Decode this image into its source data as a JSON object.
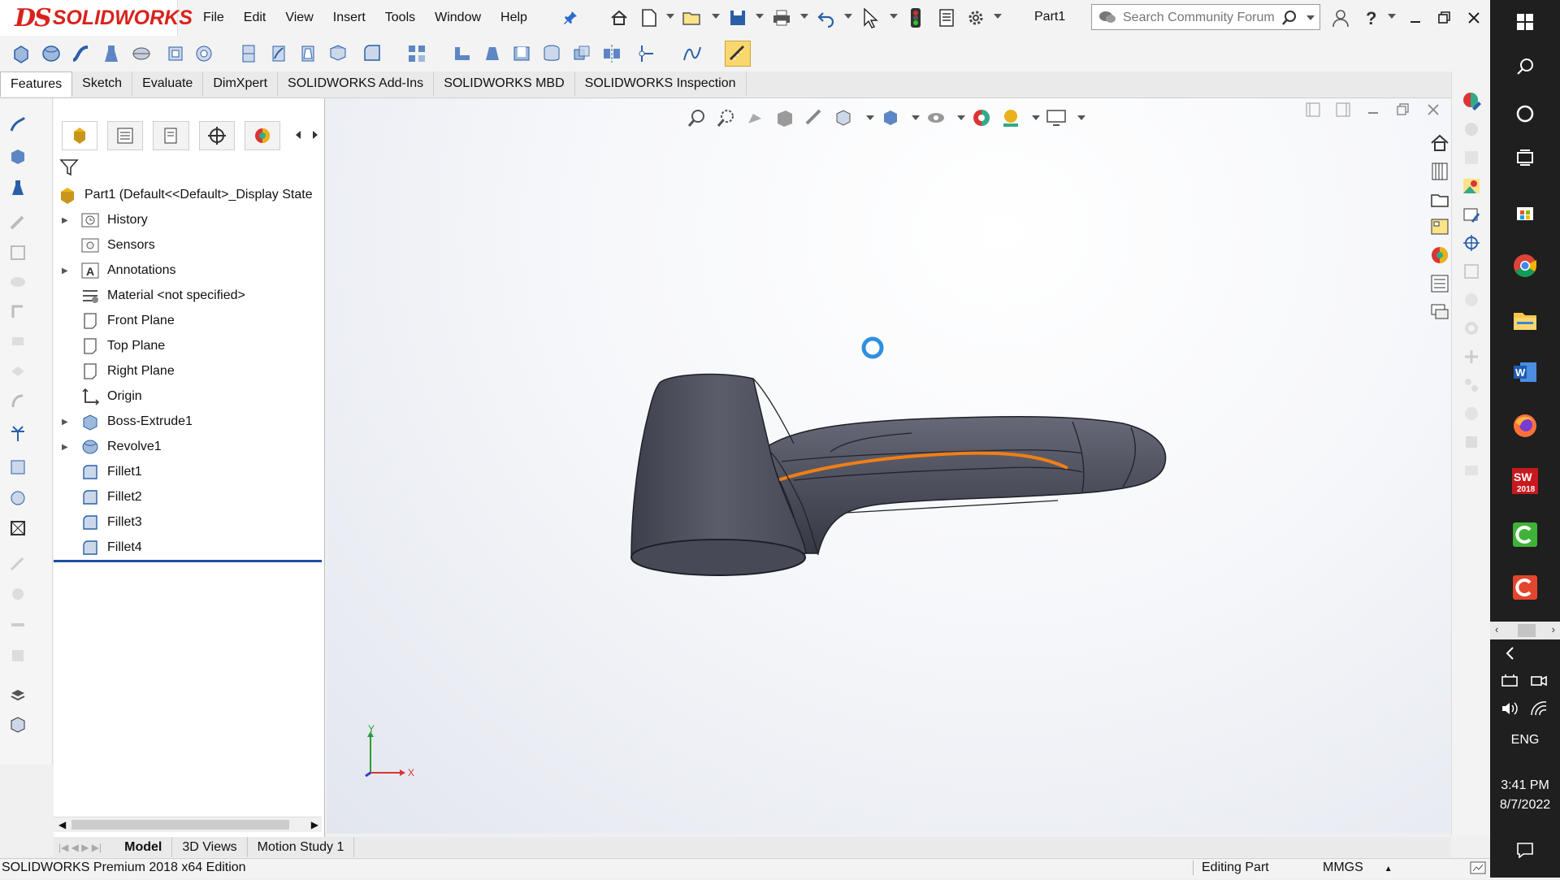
{
  "app": {
    "brand_ds": "DS",
    "brand_name": "SOLIDWORKS",
    "document_title": "Part1"
  },
  "menu": [
    "File",
    "Edit",
    "View",
    "Insert",
    "Tools",
    "Window",
    "Help"
  ],
  "search": {
    "placeholder": "Search Community Forum"
  },
  "tabs": [
    {
      "label": "Features",
      "active": true
    },
    {
      "label": "Sketch"
    },
    {
      "label": "Evaluate"
    },
    {
      "label": "DimXpert"
    },
    {
      "label": "SOLIDWORKS Add-Ins"
    },
    {
      "label": "SOLIDWORKS MBD"
    },
    {
      "label": "SOLIDWORKS Inspection"
    }
  ],
  "tree": {
    "root": "Part1  (Default<<Default>_Display State",
    "items": [
      {
        "label": "History",
        "expandable": true,
        "icon": "history-icon"
      },
      {
        "label": "Sensors",
        "expandable": false,
        "icon": "sensors-icon"
      },
      {
        "label": "Annotations",
        "expandable": true,
        "icon": "annotations-icon"
      },
      {
        "label": "Material <not specified>",
        "expandable": false,
        "icon": "material-icon"
      },
      {
        "label": "Front Plane",
        "expandable": false,
        "icon": "plane-icon"
      },
      {
        "label": "Top Plane",
        "expandable": false,
        "icon": "plane-icon"
      },
      {
        "label": "Right Plane",
        "expandable": false,
        "icon": "plane-icon"
      },
      {
        "label": "Origin",
        "expandable": false,
        "icon": "origin-icon"
      },
      {
        "label": "Boss-Extrude1",
        "expandable": true,
        "icon": "extrude-icon"
      },
      {
        "label": "Revolve1",
        "expandable": true,
        "icon": "revolve-icon"
      },
      {
        "label": "Fillet1",
        "expandable": false,
        "icon": "fillet-icon"
      },
      {
        "label": "Fillet2",
        "expandable": false,
        "icon": "fillet-icon"
      },
      {
        "label": "Fillet3",
        "expandable": false,
        "icon": "fillet-icon"
      },
      {
        "label": "Fillet4",
        "expandable": false,
        "icon": "fillet-icon"
      }
    ]
  },
  "triad": {
    "y_label": "Y",
    "x_label": "X"
  },
  "bottom_tabs": [
    "Model",
    "3D Views",
    "Motion Study 1"
  ],
  "status": {
    "edition": "SOLIDWORKS Premium 2018 x64 Edition",
    "mode": "Editing Part",
    "units": "MMGS"
  },
  "taskbar": {
    "language": "ENG",
    "time": "3:41 PM",
    "date": "8/7/2022",
    "sw_badge": "2018"
  },
  "colors": {
    "brand": "#d9221c",
    "model_body": "#4d4f5c",
    "selected_edge": "#f07f16",
    "tree_underline": "#1c4fa0",
    "taskbar": "#1f1f1f"
  }
}
